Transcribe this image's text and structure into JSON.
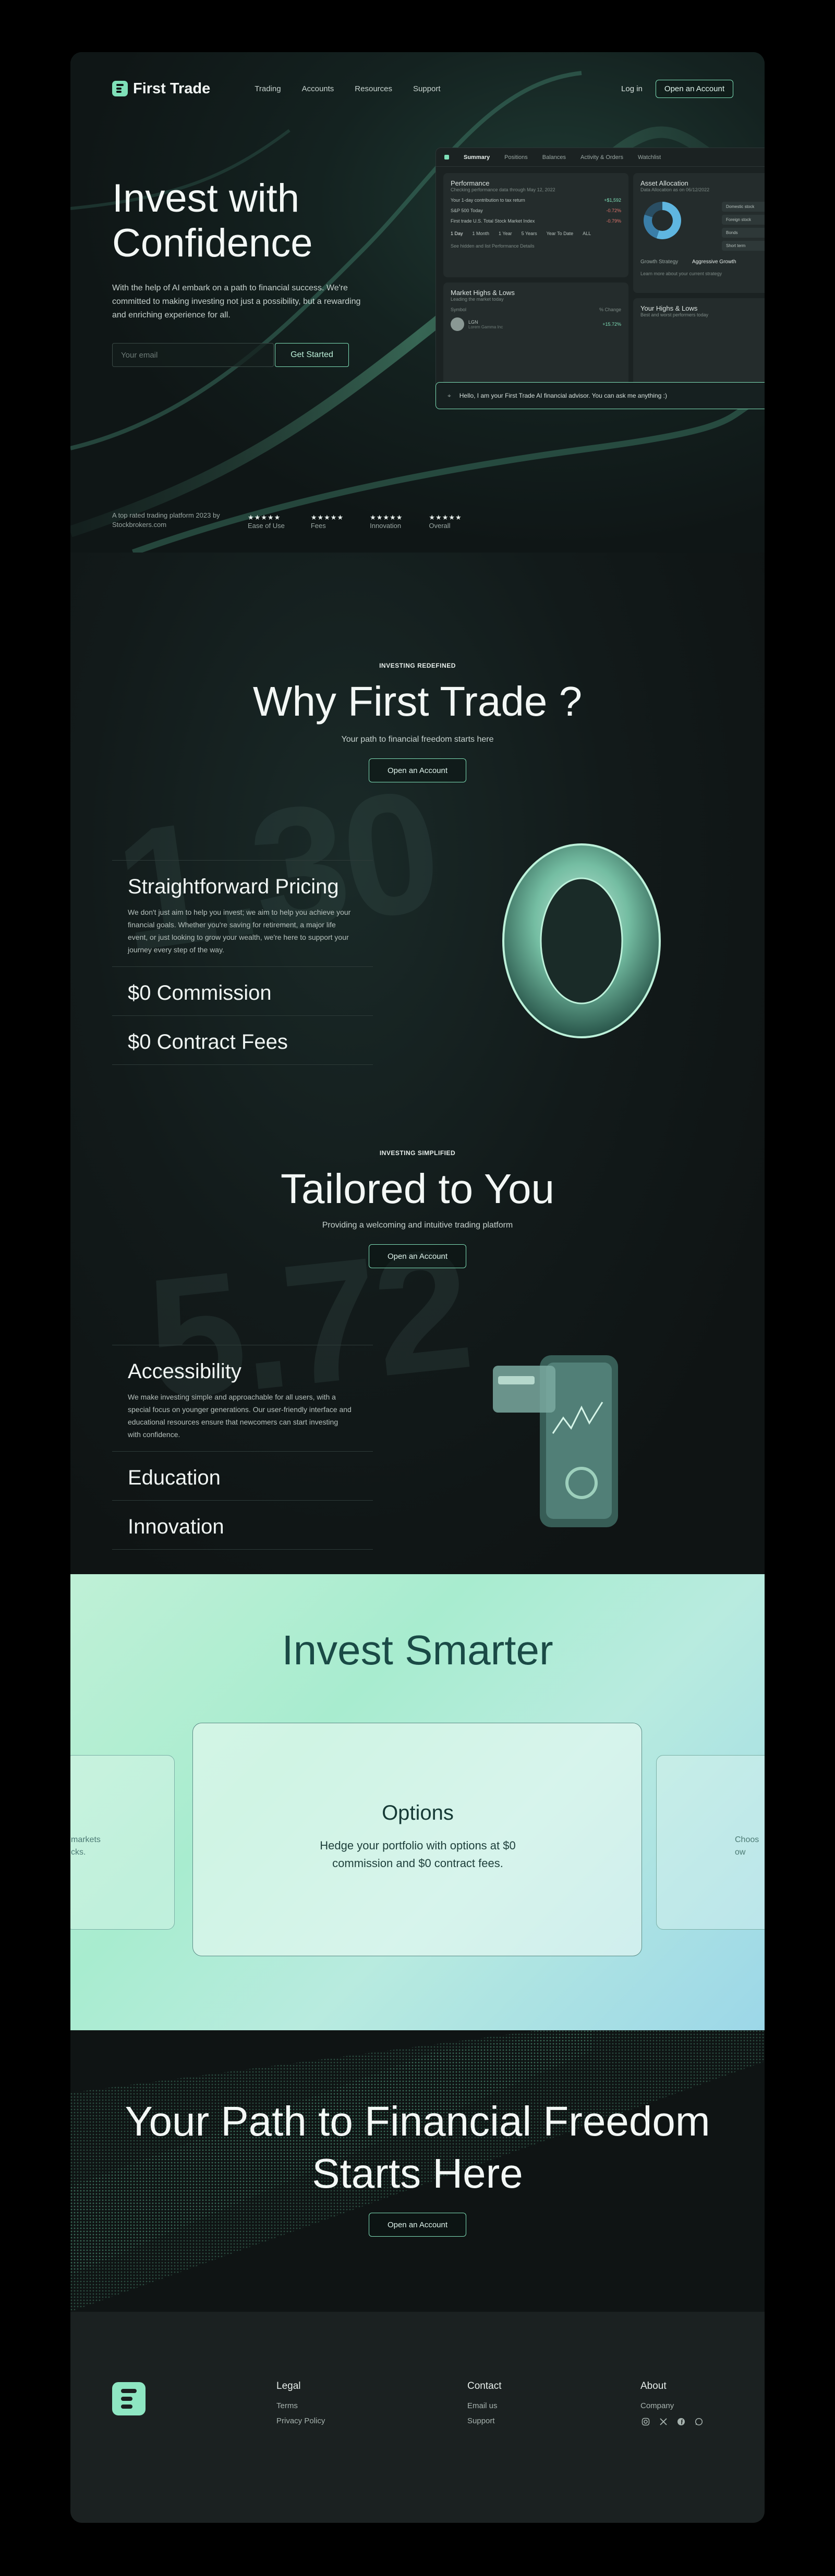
{
  "nav": {
    "brand": "First Trade",
    "menu": [
      "Trading",
      "Accounts",
      "Resources",
      "Support"
    ],
    "login": "Log in",
    "open_account": "Open an Account"
  },
  "hero": {
    "title": "Invest with Confidence",
    "subtitle": "With the help of AI embark on a path to financial success. We're committed to making investing not just a possibility, but a rewarding and enriching experience for all.",
    "email_placeholder": "Your email",
    "cta": "Get Started"
  },
  "dashboard": {
    "tabs": [
      "Summary",
      "Positions",
      "Balances",
      "Activity & Orders",
      "Watchlist"
    ],
    "performance": {
      "title": "Performance",
      "subtitle": "Checking performance data through May 12, 2022",
      "rows": [
        {
          "label": "Your 1-day contribution to tax return",
          "value": "+$1,592",
          "tone": "pos"
        },
        {
          "label": "S&P 500 Today",
          "value": "-0.72%",
          "tone": "neg"
        },
        {
          "label": "First trade U.S. Total Stock Market Index",
          "value": "-0.79%",
          "tone": "neg"
        }
      ],
      "ranges": [
        "1 Day",
        "1 Month",
        "1 Year",
        "5 Years",
        "Year To Date",
        "ALL"
      ],
      "note": "See hidden and list Performance Details"
    },
    "allocation": {
      "title": "Asset Allocation",
      "subtitle": "Data Allocation as on 06/12/2022",
      "legend": [
        "Domestic stock",
        "Foreign stock",
        "Bonds",
        "Short term"
      ],
      "strategy_label": "Growth Strategy",
      "strategy_value": "Aggressive Growth",
      "strategy_note": "Learn more about your current strategy"
    },
    "highs": {
      "title": "Market Highs & Lows",
      "subtitle": "Leading the market today",
      "col1": "Symbol",
      "col2": "% Change",
      "symbol": "LGN",
      "symbol_sub": "Lorem Gamma Inc",
      "change": "+15.72%"
    },
    "your_highs": {
      "title": "Your Highs & Lows",
      "subtitle": "Best and worst performers today"
    },
    "ai_prompt": "Hello, I am your First Trade AI financial advisor. You can ask me anything :)"
  },
  "ratings": {
    "intro": "A top rated trading platform 2023 by Stockbrokers.com",
    "stars": "★★★★★",
    "items": [
      "Ease of Use",
      "Fees",
      "Innovation",
      "Overall"
    ]
  },
  "why": {
    "eyebrow": "INVESTING REDEFINED",
    "title": "Why First Trade ?",
    "subtitle": "Your path to financial freedom starts here",
    "cta": "Open an Account",
    "feature_title": "Straightforward Pricing",
    "feature_text": "We don't just aim to help you invest; we aim to help you achieve your financial goals. Whether you're saving for retirement, a major life event, or just looking to grow your wealth, we're here to support your journey every step of the way.",
    "collapsed": [
      "$0 Commission",
      "$0 Contract Fees"
    ],
    "bg_numbers": [
      "1.30",
      "5.72"
    ]
  },
  "tailored": {
    "eyebrow": "INVESTING SIMPLIFIED",
    "title": "Tailored to You",
    "subtitle": "Providing a welcoming and intuitive trading platform",
    "cta": "Open an Account",
    "feature_title": "Accessibility",
    "feature_text": "We make investing simple and approachable for all users, with a special focus on younger generations. Our user-friendly interface and educational resources ensure that newcomers can start investing with confidence.",
    "collapsed": [
      "Education",
      "Innovation"
    ]
  },
  "smarter": {
    "title": "Invest Smarter",
    "card_title": "Options",
    "card_text": "Hedge your portfolio with options at $0 commission and $0 contract fees.",
    "left_peek": "markets\ncks.",
    "right_peek": "Choos\now"
  },
  "final_cta": {
    "title": "Your Path to Financial Freedom Starts Here",
    "cta": "Open an Account"
  },
  "footer": {
    "legal": {
      "title": "Legal",
      "links": [
        "Terms",
        "Privacy Policy"
      ]
    },
    "contact": {
      "title": "Contact",
      "links": [
        "Email us",
        "Support"
      ]
    },
    "about": {
      "title": "About",
      "links": [
        "Company"
      ]
    },
    "social_icons": [
      "instagram-icon",
      "x-icon",
      "facebook-icon",
      "whatsapp-icon"
    ]
  },
  "colors": {
    "accent": "#7fe0b8",
    "dark_bg": "#0e1314",
    "smart_bg": "#b8ecd4"
  }
}
